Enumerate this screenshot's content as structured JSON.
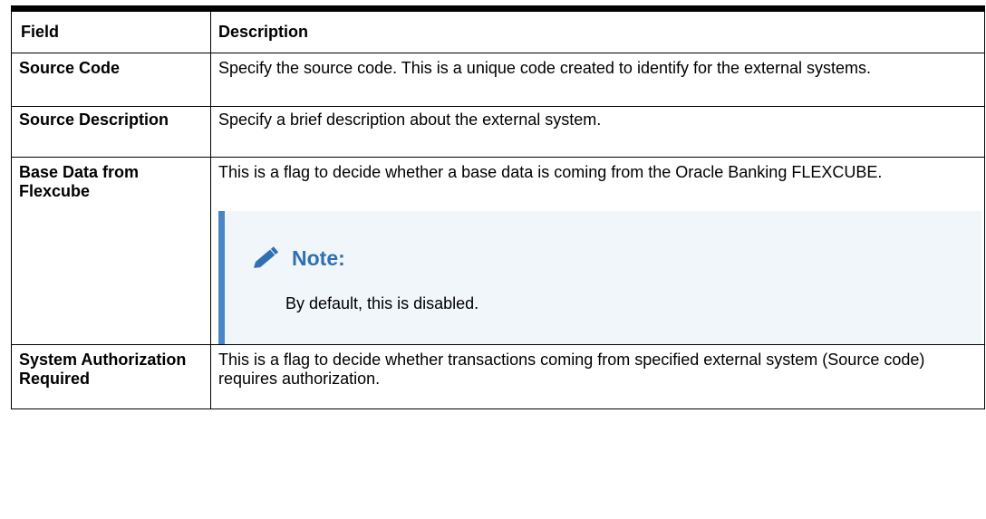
{
  "table": {
    "header": {
      "field": "Field",
      "description": "Description"
    },
    "rows": [
      {
        "field": "Source Code",
        "description": "Specify the source code. This is a unique code created to identify for the external systems."
      },
      {
        "field": "Source Description",
        "description": "Specify a brief description about the external system."
      },
      {
        "field": "Base Data from Flexcube",
        "description": "This is a flag to decide whether a base data is coming from the Oracle Banking FLEXCUBE.",
        "note": {
          "icon": "pencil-icon",
          "title": "Note:",
          "text": "By default, this is disabled."
        }
      },
      {
        "field": "System Authorization Required",
        "description": "This is a flag to decide whether transactions coming from specified external system (Source code) requires authorization."
      }
    ]
  },
  "colors": {
    "note_accent": "#4a86c5",
    "note_background": "#f1f6fb",
    "note_title": "#2e70b4"
  }
}
